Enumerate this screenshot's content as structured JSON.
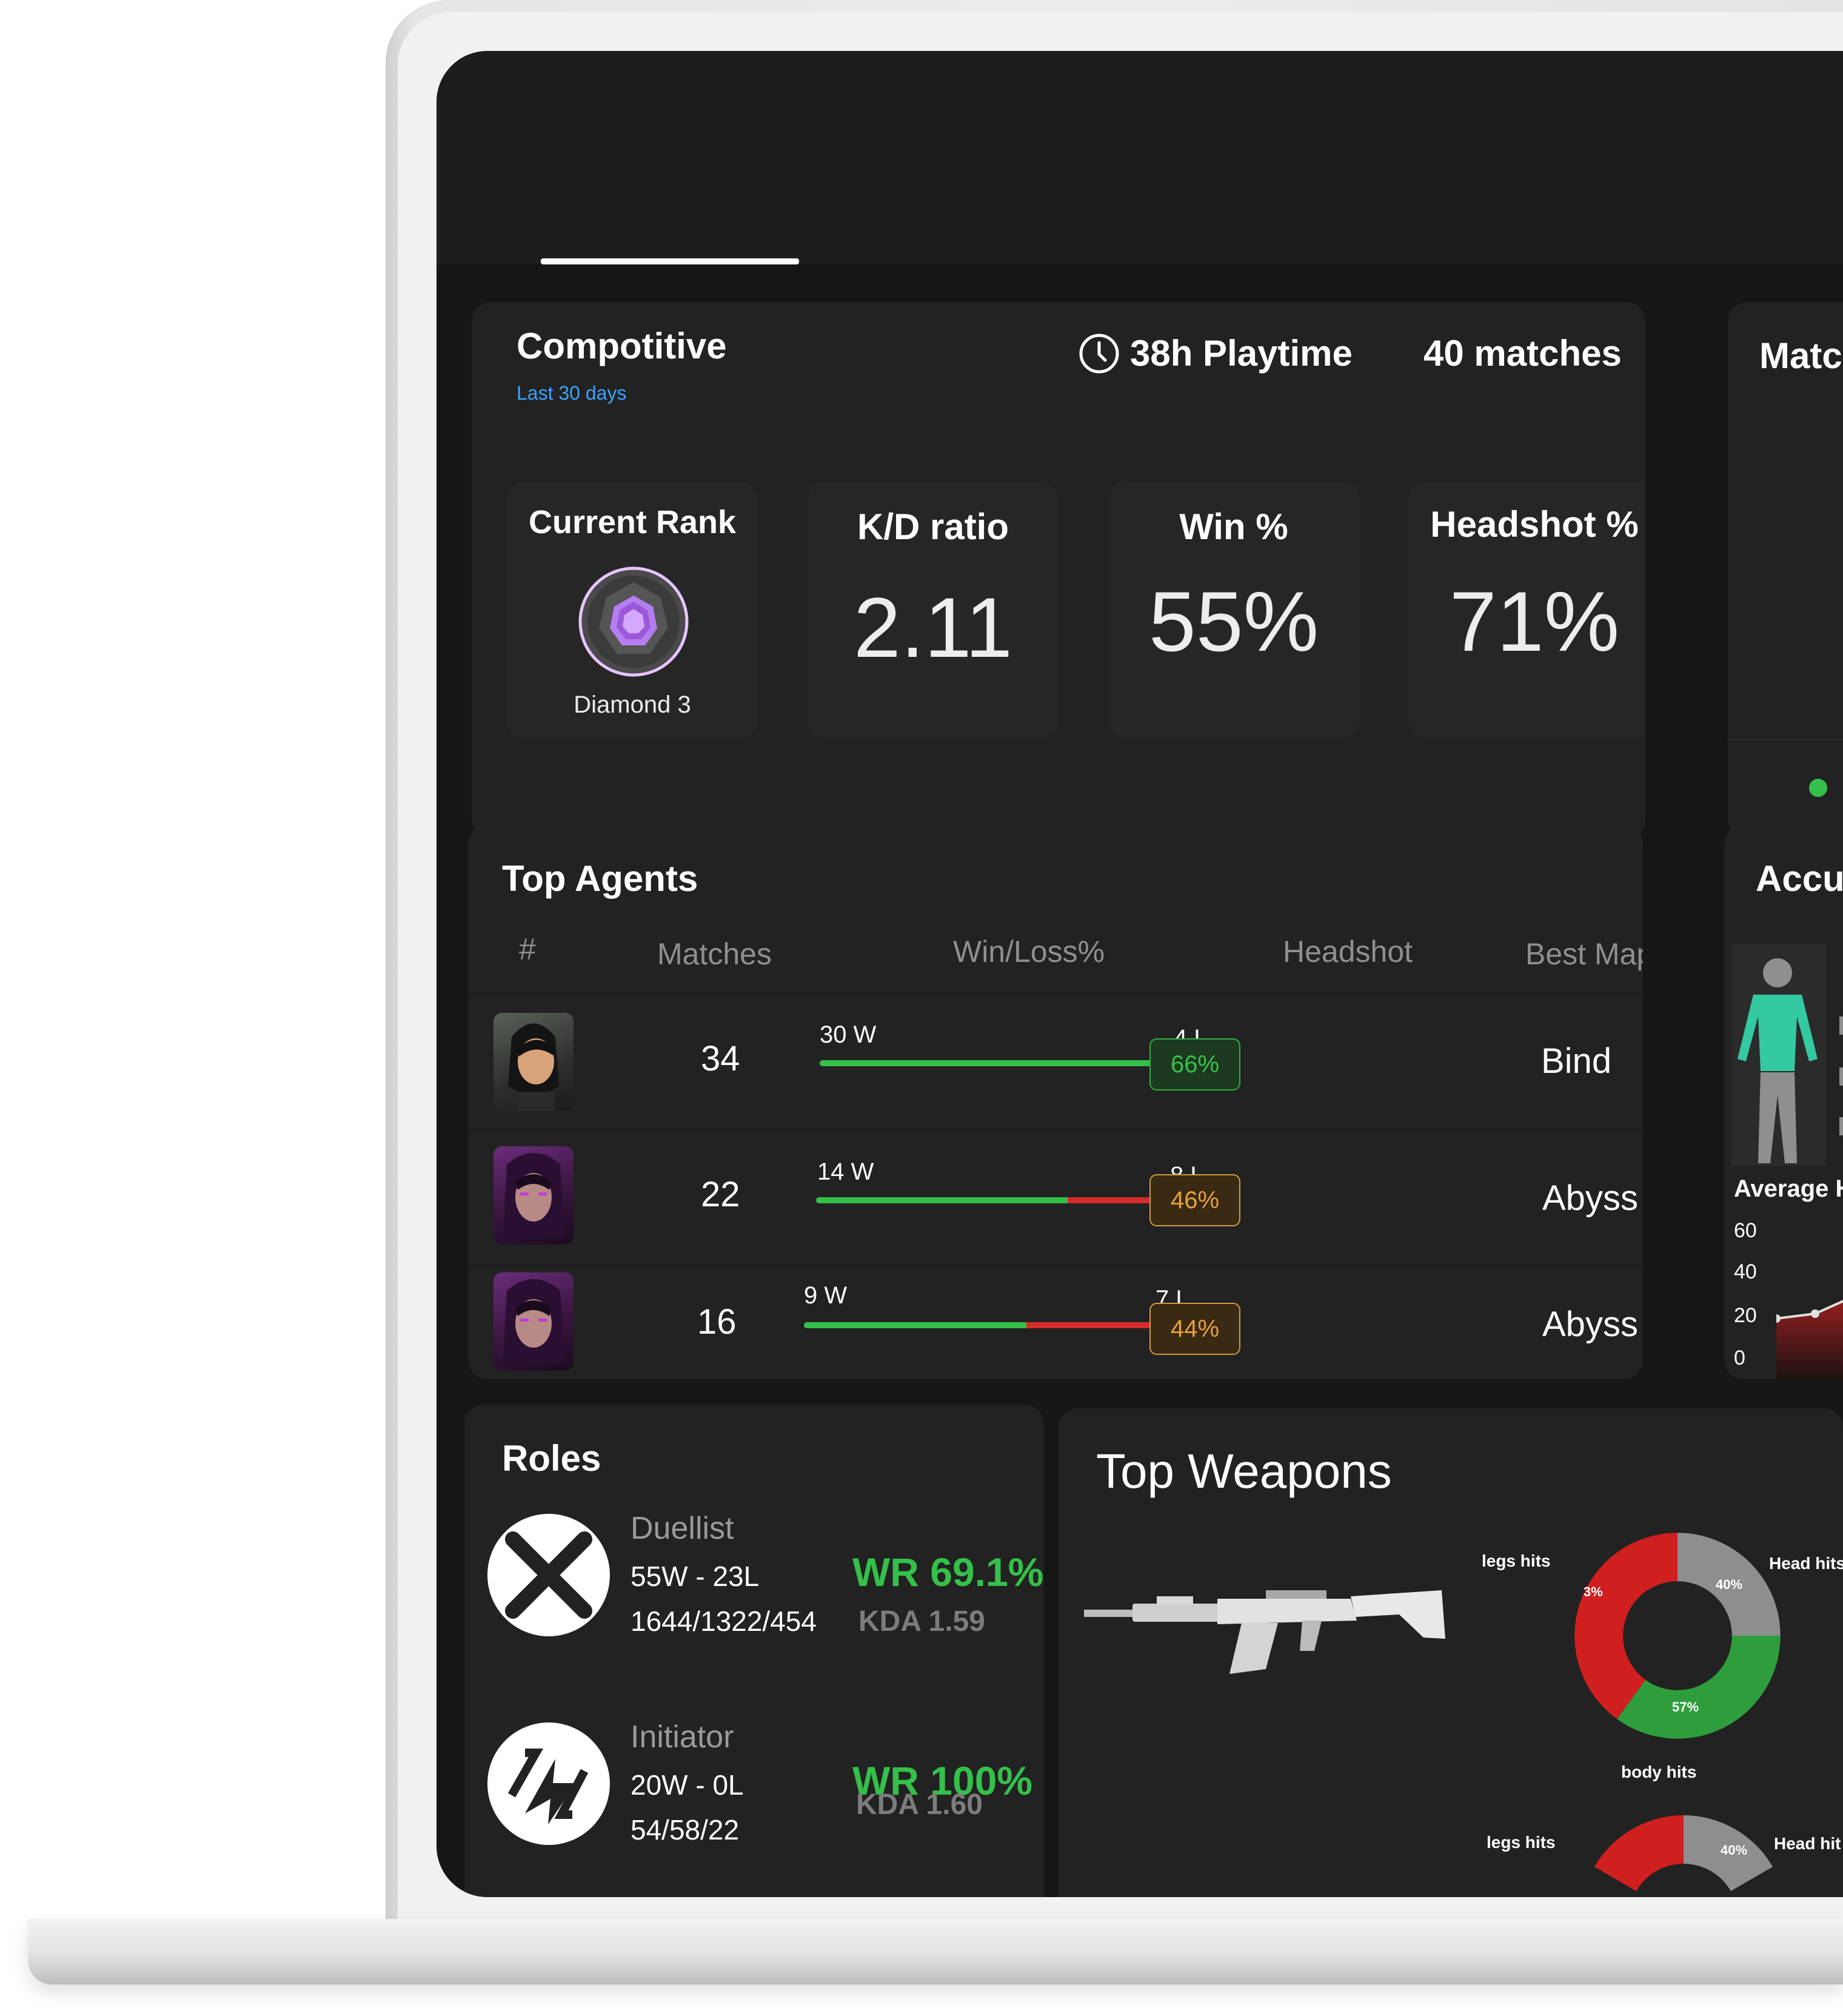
{
  "competitive": {
    "title": "Compotitive",
    "subtitle": "Last 30 days",
    "playtime": "38h Playtime",
    "matches": "40 matches",
    "stats": {
      "rank_label": "Current Rank",
      "rank_value": "Diamond 3",
      "kd_label": "K/D ratio",
      "kd_value": "2.11",
      "win_label": "Win %",
      "win_value": "55%",
      "hs_label": "Headshot %",
      "hs_value": "71%"
    }
  },
  "match_panel": {
    "title": "Matc"
  },
  "accuracy_panel": {
    "title": "Accu",
    "avg_label": "Average H",
    "y_ticks": [
      "60",
      "40",
      "20",
      "0"
    ]
  },
  "top_agents": {
    "title": "Top Agents",
    "headers": {
      "num": "#",
      "matches": "Matches",
      "winloss": "Win/Loss%",
      "headshot": "Headshot",
      "bestmap": "Best Map"
    },
    "rows": [
      {
        "matches": "34",
        "wins_label": "30 W",
        "losses_label": "4 L",
        "wins": 30,
        "losses": 4,
        "headshot": "66%",
        "map": "Bind"
      },
      {
        "matches": "22",
        "wins_label": "14 W",
        "losses_label": "8 L",
        "wins": 14,
        "losses": 8,
        "headshot": "46%",
        "map": "Abyss"
      },
      {
        "matches": "16",
        "wins_label": "9 W",
        "losses_label": "7 L",
        "wins": 9,
        "losses": 7,
        "headshot": "44%",
        "map": "Abyss"
      }
    ]
  },
  "roles": {
    "title": "Roles",
    "items": [
      {
        "name": "Duellist",
        "record": "55W - 23L",
        "kda_line": "1644/1322/454",
        "wr": "WR 69.1%",
        "kda": "KDA 1.59"
      },
      {
        "name": "Initiator",
        "record": "20W - 0L",
        "kda_line": "54/58/22",
        "wr": "WR 100%",
        "kda": "KDA 1.60"
      }
    ]
  },
  "top_weapons": {
    "title": "Top Weapons",
    "donut1": {
      "legs_label": "legs hits",
      "head_label": "Head hits",
      "body_label": "body hits",
      "legs_pct": "3%",
      "head_pct": "40%",
      "body_pct": "57%",
      "head": 25,
      "body": 35,
      "legs": 40
    },
    "donut2": {
      "legs_label": "legs hits",
      "head_label": "Head hit",
      "head_pct": "40%"
    }
  },
  "colors": {
    "green": "#34c04a",
    "red": "#d62b2b",
    "orange": "#e8a13a",
    "blue": "#3aa3ff",
    "gray": "#8e8e8e"
  }
}
